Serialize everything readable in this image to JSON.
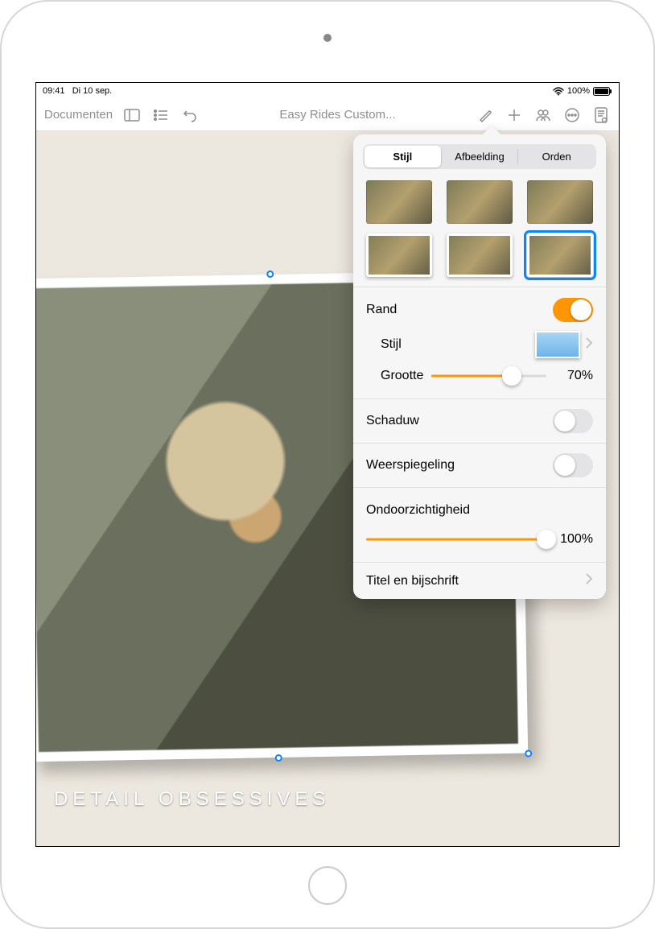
{
  "status": {
    "time": "09:41",
    "date": "Di 10 sep.",
    "battery": "100%"
  },
  "toolbar": {
    "documents": "Documenten",
    "title": "Easy Rides Custom..."
  },
  "canvas": {
    "caption": "DETAIL OBSESSIVES"
  },
  "popover": {
    "tabs": {
      "style": "Stijl",
      "image": "Afbeelding",
      "arrange": "Orden"
    },
    "border_label": "Rand",
    "border_on": true,
    "style_label": "Stijl",
    "size_label": "Grootte",
    "size_value": "70%",
    "size_pct": 70,
    "shadow_label": "Schaduw",
    "shadow_on": false,
    "reflection_label": "Weerspiegeling",
    "reflection_on": false,
    "opacity_label": "Ondoorzichtigheid",
    "opacity_value": "100%",
    "opacity_pct": 100,
    "title_caption_label": "Titel en bijschrift"
  }
}
